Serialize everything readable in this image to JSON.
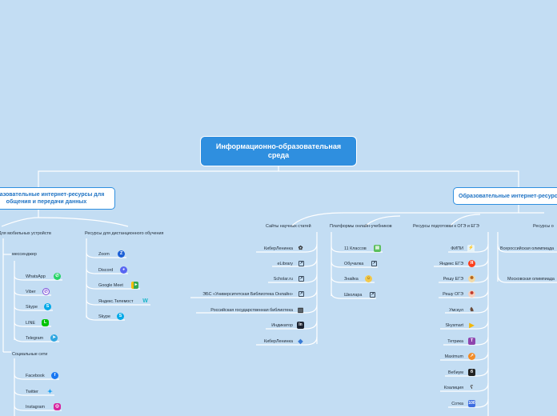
{
  "root": "Информационно-образовательная среда",
  "left_main": "Образовательные интернет-ресурсы для общения и передачи данных",
  "right_main": "Образовательные интернет-ресурсы",
  "left_cats": {
    "mobile": "Для мобильных устройств",
    "messenger": "мессенджер",
    "social": "Социальные сети",
    "remote": "Ресурсы для дистанционного обучения"
  },
  "messengers": [
    "WhatsApp",
    "Viber",
    "Skype",
    "LINE",
    "Telegram"
  ],
  "social_nets": [
    "Facebook",
    "Twitter",
    "Instagram"
  ],
  "remote_tools": [
    "Zoom",
    "Discord",
    "Google Meet",
    "Яндекс.Телемост",
    "Skype"
  ],
  "right_cats": {
    "science": "Сайты научных статей",
    "platforms": "Платформы онлайн-учебников",
    "exam": "Ресурсы подготовки к ОГЭ и ЕГЭ",
    "olymp": "Ресурсы о"
  },
  "science_sites": [
    "КиберЛенинка",
    "eLibrary",
    "Scholar.ru",
    "ЭБС «Университетская Библиотека Онлайн»",
    "Российская государственная библиотека",
    "Индикатор",
    "КиберЛенинка"
  ],
  "platforms": [
    "11 Классов",
    "Обучалка",
    "Знайка",
    "Школара"
  ],
  "exam_sites": [
    "ФИПИ",
    "Яндекс ЕГЭ",
    "Решу ЕГЭ",
    "Решу ОГЭ",
    "Умскул",
    "Skysmart",
    "Тетрика",
    "Maximum",
    "Вебиум",
    "Коалиция",
    "Сотка"
  ],
  "olymp_sites": [
    "Всероссийская олимпиада",
    "Московская олимпиада"
  ],
  "icons": {
    "messengers": [
      "whatsapp-icon",
      "viber-icon",
      "skype-icon",
      "line-icon",
      "telegram-icon"
    ],
    "social": [
      "facebook-icon",
      "twitter-icon",
      "instagram-icon"
    ],
    "remote": [
      "zoom-icon",
      "discord-icon",
      "google-meet-icon",
      "yandex-telemost-icon",
      "skype-icon"
    ]
  },
  "colors": {
    "background": "#c3ddf3",
    "accent": "#2f8fdf",
    "line": "#ffffff"
  }
}
